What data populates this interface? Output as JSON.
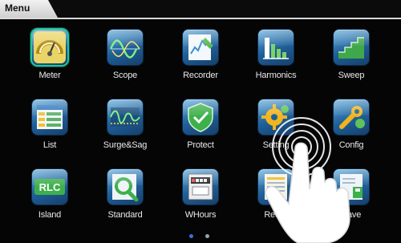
{
  "header": {
    "tab_label": "Menu"
  },
  "tiles": [
    {
      "label": "Meter",
      "icon": "meter-gauge-icon"
    },
    {
      "label": "Scope",
      "icon": "scope-waveform-icon"
    },
    {
      "label": "Recorder",
      "icon": "recorder-chart-icon"
    },
    {
      "label": "Harmonics",
      "icon": "harmonics-bars-icon"
    },
    {
      "label": "Sweep",
      "icon": "sweep-steps-icon"
    },
    {
      "label": "List",
      "icon": "list-table-icon"
    },
    {
      "label": "Surge&Sag",
      "icon": "surge-sag-icon"
    },
    {
      "label": "Protect",
      "icon": "protect-shield-icon"
    },
    {
      "label": "Setting",
      "icon": "setting-gear-icon"
    },
    {
      "label": "Config",
      "icon": "config-wrench-icon"
    },
    {
      "label": "Island",
      "icon": "island-text-icon"
    },
    {
      "label": "Standard",
      "icon": "standard-magnifier-icon"
    },
    {
      "label": "WHours",
      "icon": "whours-meter-icon"
    },
    {
      "label": "Recall",
      "icon": "recall-document-icon"
    },
    {
      "label": "Save",
      "icon": "save-document-icon"
    }
  ],
  "island_icon_text": "RLC",
  "selected_tile": "Meter",
  "page_indicator": {
    "current": 1,
    "total": 2
  },
  "colors": {
    "selected_outline": "#20c79b",
    "active_dot": "#3b6fe0",
    "inactive_dot": "#9aa3ad"
  }
}
